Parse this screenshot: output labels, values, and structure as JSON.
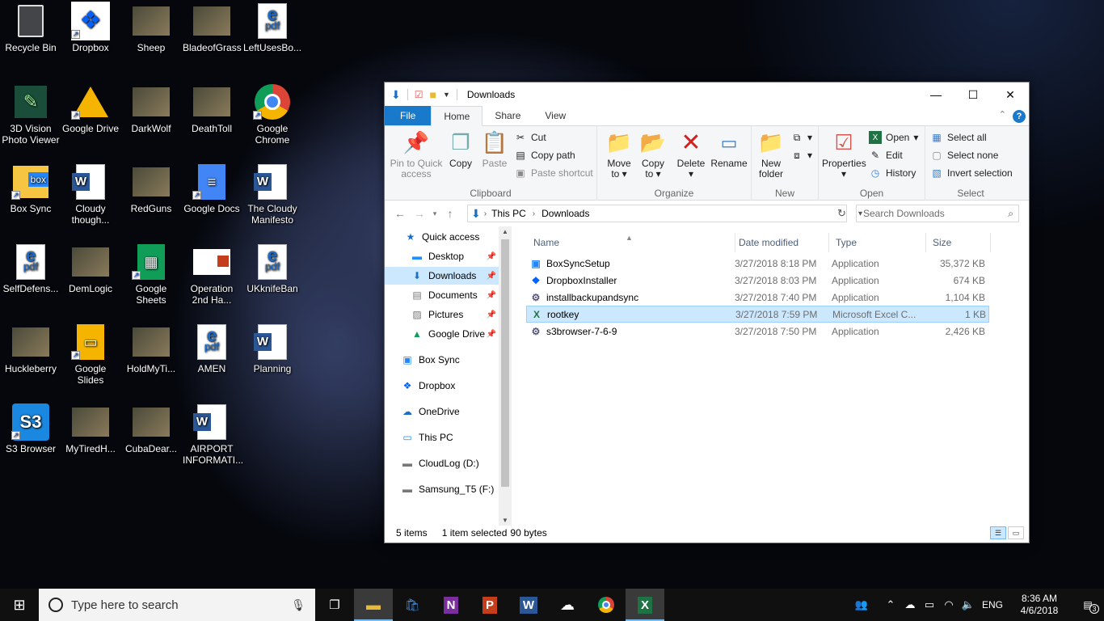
{
  "desktop_icons": [
    {
      "id": "recycle",
      "label": "Recycle Bin",
      "icon": "recycle-bin-icon"
    },
    {
      "id": "dropbox",
      "label": "Dropbox",
      "icon": "dropbox-icon"
    },
    {
      "id": "sheep",
      "label": "Sheep",
      "icon": "image-thumbnail"
    },
    {
      "id": "bladeofgrass",
      "label": "BladeofGrass",
      "icon": "image-thumbnail"
    },
    {
      "id": "leftusesbo",
      "label": "LeftUsesBo...",
      "icon": "pdf-icon"
    },
    {
      "id": "3dvision",
      "label": "3D Vision Photo Viewer",
      "icon": "3d-vision-icon"
    },
    {
      "id": "googledrive",
      "label": "Google Drive",
      "icon": "google-drive-icon"
    },
    {
      "id": "darkwolf",
      "label": "DarkWolf",
      "icon": "image-thumbnail"
    },
    {
      "id": "deathtoll",
      "label": "DeathToll",
      "icon": "image-thumbnail"
    },
    {
      "id": "chrome",
      "label": "Google Chrome",
      "icon": "chrome-icon"
    },
    {
      "id": "boxsync",
      "label": "Box Sync",
      "icon": "box-icon"
    },
    {
      "id": "cloudy",
      "label": "Cloudy though...",
      "icon": "word-icon"
    },
    {
      "id": "redguns",
      "label": "RedGuns",
      "icon": "image-thumbnail"
    },
    {
      "id": "gdocs",
      "label": "Google Docs",
      "icon": "google-docs-icon"
    },
    {
      "id": "cloudymanifesto",
      "label": "The Cloudy Manifesto",
      "icon": "word-icon"
    },
    {
      "id": "selfdefense",
      "label": "SelfDefens...",
      "icon": "pdf-icon"
    },
    {
      "id": "demlogic",
      "label": "DemLogic",
      "icon": "image-thumbnail"
    },
    {
      "id": "gsheets",
      "label": "Google Sheets",
      "icon": "google-sheets-icon"
    },
    {
      "id": "operation",
      "label": "Operation 2nd Ha...",
      "icon": "powerpoint-icon"
    },
    {
      "id": "ukknife",
      "label": "UKknifeBan",
      "icon": "pdf-icon"
    },
    {
      "id": "huckleberry",
      "label": "Huckleberry",
      "icon": "image-thumbnail"
    },
    {
      "id": "gslides",
      "label": "Google Slides",
      "icon": "google-slides-icon"
    },
    {
      "id": "holdmyti",
      "label": "HoldMyTi...",
      "icon": "image-thumbnail"
    },
    {
      "id": "amen",
      "label": "AMEN",
      "icon": "pdf-icon"
    },
    {
      "id": "planning",
      "label": "Planning",
      "icon": "word-icon"
    },
    {
      "id": "s3browser",
      "label": "S3 Browser",
      "icon": "s3-icon"
    },
    {
      "id": "mytiredh",
      "label": "MyTiredH...",
      "icon": "image-thumbnail"
    },
    {
      "id": "cubadear",
      "label": "CubaDear...",
      "icon": "image-thumbnail"
    },
    {
      "id": "airport",
      "label": "AIRPORT INFORMATI...",
      "icon": "word-icon"
    }
  ],
  "s3_text": "S3",
  "box_text": "box",
  "pdf_text": "pdf",
  "w_text": "W",
  "window": {
    "title": "Downloads",
    "controls": {
      "minimize": "—",
      "maximize": "☐",
      "close": "✕"
    },
    "tabs": {
      "file": "File",
      "home": "Home",
      "share": "Share",
      "view": "View"
    },
    "help": "?",
    "ribbon": {
      "clipboard": {
        "label": "Clipboard",
        "pin": "Pin to Quick access",
        "copy": "Copy",
        "paste": "Paste",
        "cut": "Cut",
        "copy_path": "Copy path",
        "paste_shortcut": "Paste shortcut"
      },
      "organize": {
        "label": "Organize",
        "move_to": "Move to",
        "copy_to": "Copy to",
        "delete": "Delete",
        "rename": "Rename"
      },
      "new": {
        "label": "New",
        "new_folder": "New folder"
      },
      "open": {
        "label": "Open",
        "properties": "Properties",
        "open": "Open",
        "edit": "Edit",
        "history": "History"
      },
      "select": {
        "label": "Select",
        "select_all": "Select all",
        "select_none": "Select none",
        "invert": "Invert selection"
      }
    },
    "address": {
      "this_pc": "This PC",
      "downloads": "Downloads",
      "search_placeholder": "Search Downloads"
    },
    "nav": [
      {
        "label": "Quick access",
        "icon": "star-icon",
        "pin": false
      },
      {
        "label": "Desktop",
        "icon": "desktop-icon",
        "pin": true
      },
      {
        "label": "Downloads",
        "icon": "download-icon",
        "pin": true,
        "selected": true
      },
      {
        "label": "Documents",
        "icon": "documents-icon",
        "pin": true
      },
      {
        "label": "Pictures",
        "icon": "pictures-icon",
        "pin": true
      },
      {
        "label": "Google Drive",
        "icon": "google-drive-icon",
        "pin": true
      },
      {
        "label": "Box Sync",
        "icon": "box-icon",
        "pin": false
      },
      {
        "label": "Dropbox",
        "icon": "dropbox-icon",
        "pin": false
      },
      {
        "label": "OneDrive",
        "icon": "onedrive-icon",
        "pin": false
      },
      {
        "label": "This PC",
        "icon": "pc-icon",
        "pin": false
      },
      {
        "label": "CloudLog (D:)",
        "icon": "drive-icon",
        "pin": false
      },
      {
        "label": "Samsung_T5 (F:)",
        "icon": "drive-icon",
        "pin": false
      }
    ],
    "columns": {
      "name": "Name",
      "date": "Date modified",
      "type": "Type",
      "size": "Size"
    },
    "files": [
      {
        "name": "BoxSyncSetup",
        "date": "3/27/2018 8:18 PM",
        "type": "Application",
        "size": "35,372 KB",
        "icon": "box-installer-icon"
      },
      {
        "name": "DropboxInstaller",
        "date": "3/27/2018 8:03 PM",
        "type": "Application",
        "size": "674 KB",
        "icon": "dropbox-icon"
      },
      {
        "name": "installbackupandsync",
        "date": "3/27/2018 7:40 PM",
        "type": "Application",
        "size": "1,104 KB",
        "icon": "installer-icon"
      },
      {
        "name": "rootkey",
        "date": "3/27/2018 7:59 PM",
        "type": "Microsoft Excel C...",
        "size": "1 KB",
        "icon": "excel-csv-icon",
        "selected": true
      },
      {
        "name": "s3browser-7-6-9",
        "date": "3/27/2018 7:50 PM",
        "type": "Application",
        "size": "2,426 KB",
        "icon": "installer-icon"
      }
    ],
    "status": {
      "items": "5 items",
      "selected": "1 item selected",
      "bytes": "90 bytes"
    }
  },
  "taskbar": {
    "search_placeholder": "Type here to search",
    "lang": "ENG",
    "time": "8:36 AM",
    "date": "4/6/2018",
    "notifications": "3"
  },
  "colors": {
    "accent": "#1979ca",
    "selection": "#cce8ff",
    "taskbar": "#101010"
  }
}
